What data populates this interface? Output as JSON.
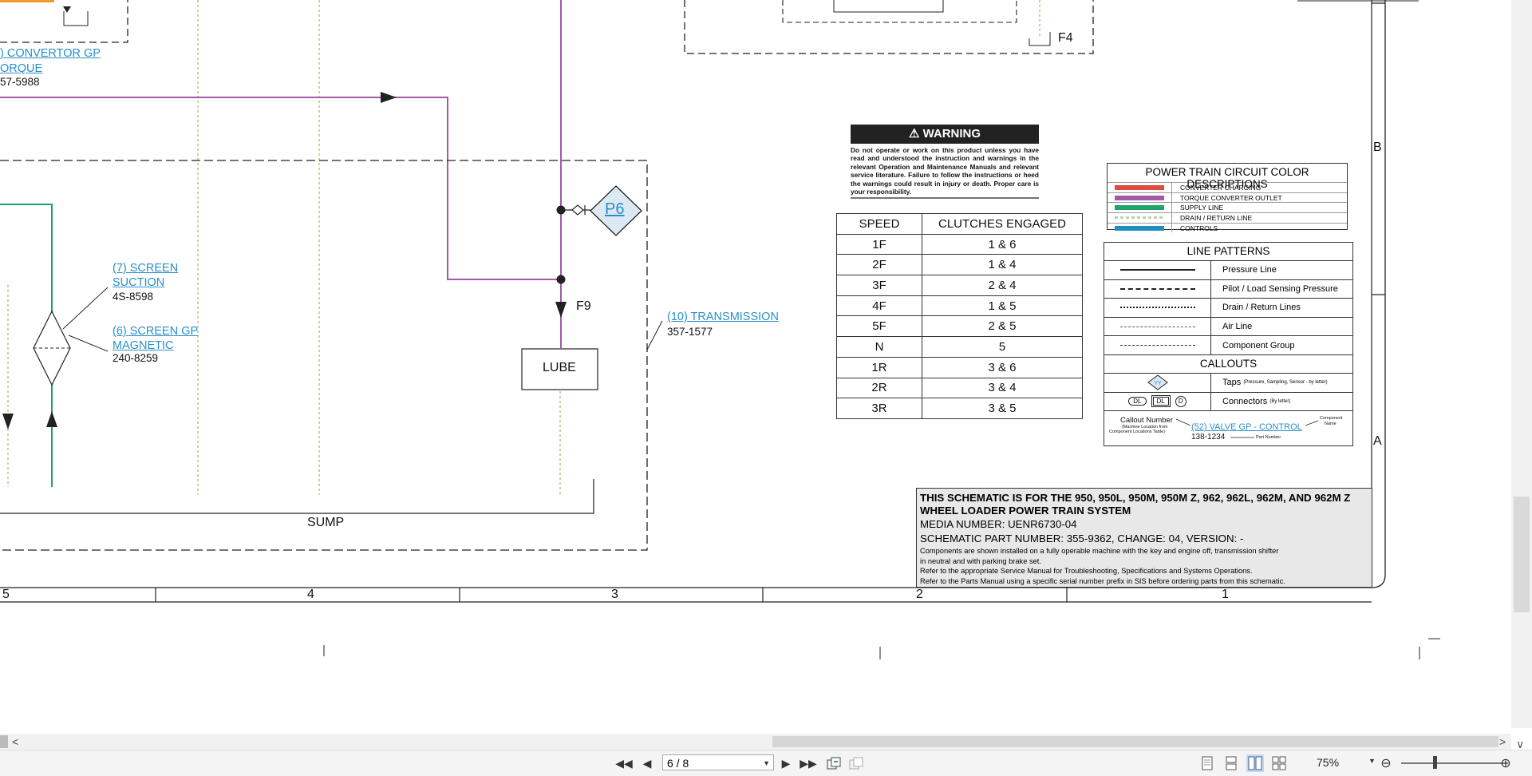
{
  "colors": {
    "purple_line": "#a05aa8",
    "green_line": "#1fa36b",
    "drain_line": "#c3bd8b",
    "red": "#e04a3f",
    "blue": "#1f8fc0",
    "accent_orange": "#f39a2e",
    "link": "#2a8fc6"
  },
  "schematic": {
    "callouts": {
      "convertor": {
        "line1": ") CONVERTOR GP",
        "line2": "ORQUE",
        "part": "57-5988"
      },
      "screen_suction": {
        "line1": "(7) SCREEN",
        "line2": "SUCTION",
        "part": "4S-8598"
      },
      "screen_magnetic": {
        "line1": "(6) SCREEN GP",
        "line2": "MAGNETIC",
        "part": "240-8259"
      },
      "transmission": {
        "line1": "(10) TRANSMISSION",
        "part": "357-1577"
      }
    },
    "tap_p6": "P6",
    "f9": "F9",
    "f4": "F4",
    "lube": "LUBE",
    "sump": "SUMP",
    "zone_b": "B",
    "zone_a": "A",
    "columns": [
      "5",
      "4",
      "3",
      "2",
      "1"
    ]
  },
  "warning": {
    "title": "WARNING",
    "text": "Do not operate or work on this product unless you have read and understood the instruction and warnings in the relevant Operation and Maintenance Manuals and relevant service literature. Failure to follow the instructions or heed the warnings could result in injury or death. Proper care is your responsibility."
  },
  "speed_table": {
    "headers": [
      "SPEED",
      "CLUTCHES ENGAGED"
    ],
    "rows": [
      [
        "1F",
        "1 & 6"
      ],
      [
        "2F",
        "1 & 4"
      ],
      [
        "3F",
        "2 & 4"
      ],
      [
        "4F",
        "1 & 5"
      ],
      [
        "5F",
        "2 & 5"
      ],
      [
        "N",
        "5"
      ],
      [
        "1R",
        "3 & 6"
      ],
      [
        "2R",
        "3 & 4"
      ],
      [
        "3R",
        "3 & 5"
      ]
    ]
  },
  "color_descriptions": {
    "title": "POWER TRAIN CIRCUIT COLOR DESCRIPTIONS",
    "items": [
      {
        "label": "CONVERTER CHARGING",
        "color": "#e04a3f"
      },
      {
        "label": "TORQUE CONVERTER OUTLET",
        "color": "#a05aa8"
      },
      {
        "label": "SUPPLY LINE",
        "color": "#1fa36b"
      },
      {
        "label": "DRAIN / RETURN LINE",
        "color": "#b7d4a4"
      },
      {
        "label": "CONTROLS",
        "color": "#1f8fc0"
      }
    ]
  },
  "line_patterns": {
    "title": "LINE PATTERNS",
    "items": [
      "Pressure Line",
      "Pilot / Load Sensing Pressure",
      "Drain / Return Lines",
      "Air Line",
      "Component Group"
    ],
    "callouts_title": "CALLOUTS",
    "taps_label": "Taps",
    "taps_note": "(Pressure, Sampling, Sensor - by letter)",
    "connectors_label": "Connectors",
    "connectors_note": "(By letter)",
    "tap_glyph": "YY",
    "conn_dl": "DL",
    "conn_d": "D",
    "callout_number": "Callout Number",
    "callout_number_note1": "(Machine Location from",
    "callout_number_note2": "Component Locations Table)",
    "example_link": "(52) VALVE GP - CONTROL",
    "example_part": "138-1234",
    "component_name1": "Component",
    "component_name2": "Name",
    "part_number": "Part Number"
  },
  "schematic_note": {
    "title1": "THIS SCHEMATIC IS FOR THE 950, 950L, 950M, 950M Z, 962, 962L, 962M, AND 962M Z",
    "title2": "WHEEL LOADER POWER TRAIN SYSTEM",
    "media": "MEDIA NUMBER: UENR6730-04",
    "part": "SCHEMATIC PART NUMBER: 355-9362, CHANGE: 04, VERSION: -",
    "line1": "Components are shown installed on a fully operable machine with the key and engine off, transmission shifter",
    "line2": "in neutral and with parking brake set.",
    "line3": "Refer to the appropriate Service Manual for Troubleshooting, Specifications and Systems Operations.",
    "line4": "Refer to the Parts Manual using a specific serial number prefix in SIS before ordering parts from this schematic."
  },
  "viewer": {
    "page_indicator": "6 / 8",
    "zoom": "75%"
  }
}
